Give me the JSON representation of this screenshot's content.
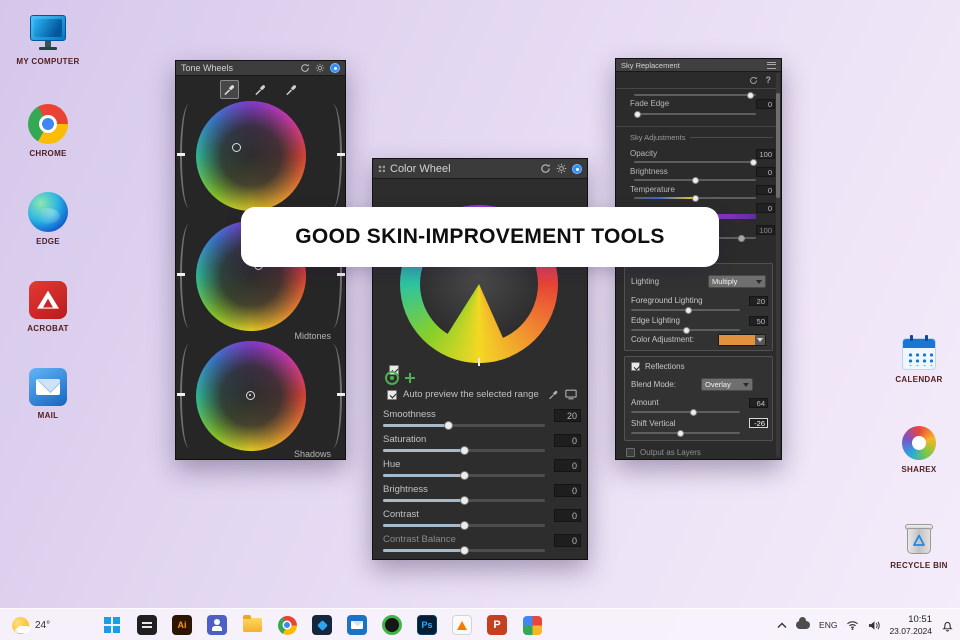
{
  "desktop": {
    "icons_left": [
      {
        "label": "MY COMPUTER"
      },
      {
        "label": "CHROME"
      },
      {
        "label": "EDGE"
      },
      {
        "label": "ACROBAT"
      },
      {
        "label": "MAIL"
      }
    ],
    "icons_right": [
      {
        "label": "CALENDAR"
      },
      {
        "label": "SHAREX"
      },
      {
        "label": "RECYCLE BIN"
      }
    ]
  },
  "banner": {
    "text": "GOOD SKIN-IMPROVEMENT TOOLS"
  },
  "panels": {
    "tone_wheels": {
      "title": "Tone Wheels",
      "wheel_labels": [
        "",
        "Midtones",
        "Shadows"
      ]
    },
    "color_wheel": {
      "title": "Color Wheel",
      "auto_preview": "Auto preview the selected range",
      "sliders": [
        {
          "label": "Smoothness",
          "value": "20"
        },
        {
          "label": "Saturation",
          "value": "0"
        },
        {
          "label": "Hue",
          "value": "0"
        },
        {
          "label": "Brightness",
          "value": "0"
        },
        {
          "label": "Contrast",
          "value": "0"
        },
        {
          "label": "Contrast Balance",
          "value": "0"
        }
      ]
    },
    "sky_replacement": {
      "title": "Sky Replacement",
      "fade_edge": {
        "label": "Fade Edge",
        "value": "0"
      },
      "section_sky_adjustments": "Sky Adjustments",
      "adjustment_sliders": [
        {
          "label": "Opacity",
          "value": "100"
        },
        {
          "label": "Brightness",
          "value": "0"
        },
        {
          "label": "Temperature",
          "value": "0"
        },
        {
          "label": "",
          "value": "0"
        },
        {
          "label": "",
          "value": "100"
        }
      ],
      "lighting": {
        "label": "Lighting",
        "dropdown_value": "Multiply",
        "foreground_lighting": {
          "label": "Foreground Lighting",
          "value": "20"
        },
        "edge_lighting": {
          "label": "Edge Lighting",
          "value": "50"
        },
        "color_adjustment_label": "Color Adjustment:",
        "swatch_color": "#e2913c"
      },
      "reflections": {
        "label": "Reflections",
        "blend_mode_label": "Blend Mode:",
        "blend_mode_value": "Overlay",
        "amount_label": "Amount",
        "amount_value": "64",
        "shift_vertical_label": "Shift Vertical",
        "shift_vertical_value": "-26"
      },
      "output_label": "Output as Layers"
    }
  },
  "taskbar": {
    "weather_temp": "24°",
    "apps": [
      {
        "name": "start"
      },
      {
        "name": "dark-app"
      },
      {
        "name": "illustrator",
        "glyph": "Ai"
      },
      {
        "name": "teams"
      },
      {
        "name": "file-explorer"
      },
      {
        "name": "chrome"
      },
      {
        "name": "code"
      },
      {
        "name": "outlook"
      },
      {
        "name": "on1"
      },
      {
        "name": "photoshop",
        "glyph": "Ps"
      },
      {
        "name": "vlc"
      },
      {
        "name": "powerpoint",
        "glyph": "P"
      },
      {
        "name": "photos"
      }
    ],
    "tray": {
      "language": "ENG",
      "time": "10:51",
      "date": "23.07.2024"
    }
  }
}
